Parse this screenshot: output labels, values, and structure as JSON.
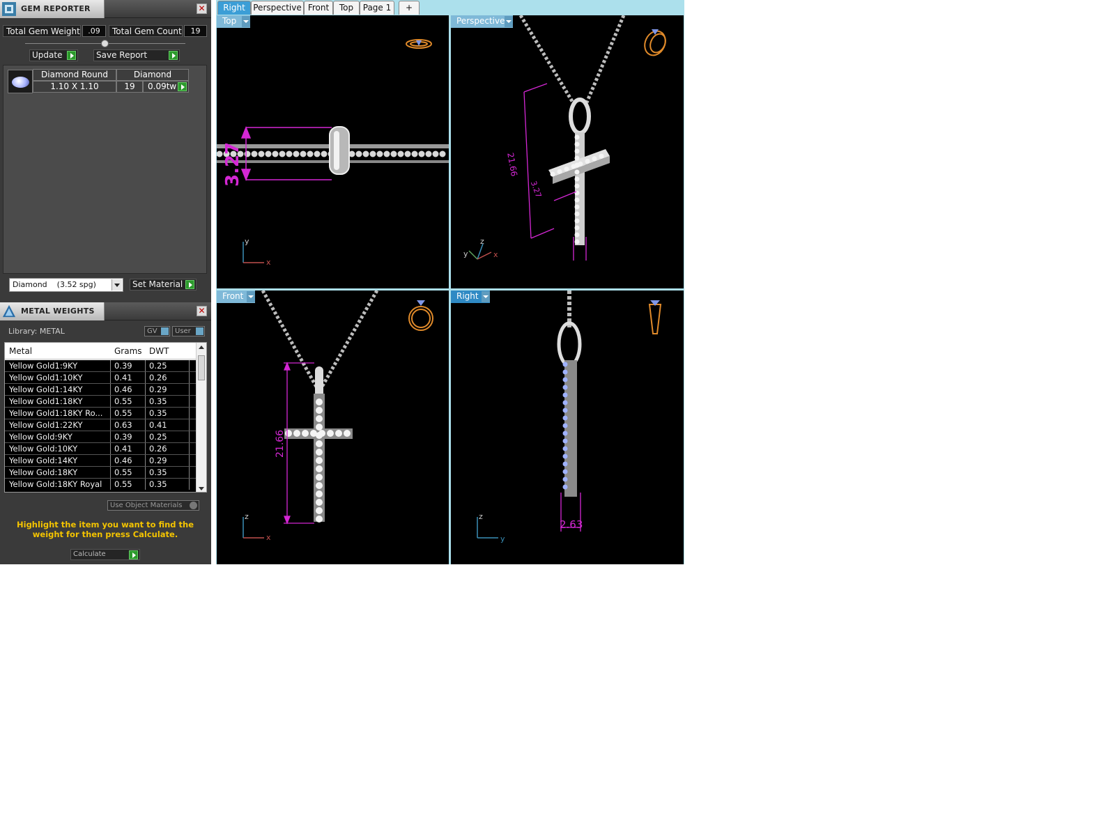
{
  "gem_reporter": {
    "title": "GEM REPORTER",
    "total_weight_label": "Total Gem Weight",
    "total_weight_value": ".09",
    "total_count_label": "Total Gem Count",
    "total_count_value": "19",
    "update_label": "Update",
    "save_label": "Save Report",
    "gem": {
      "shape": "Diamond Round",
      "material": "Diamond",
      "size": "1.10 X 1.10",
      "count": "19",
      "weight": "0.09tw"
    },
    "material_select": "Diamond    (3.52 spg)",
    "set_material_label": "Set Material"
  },
  "metal_weights": {
    "title": "METAL WEIGHTS",
    "library_label": "Library: METAL",
    "gv_label": "GV",
    "user_label": "User",
    "columns": [
      "Metal",
      "Grams",
      "DWT"
    ],
    "rows": [
      [
        "Yellow Gold1:9KY",
        "0.39",
        "0.25"
      ],
      [
        "Yellow Gold1:10KY",
        "0.41",
        "0.26"
      ],
      [
        "Yellow Gold1:14KY",
        "0.46",
        "0.29"
      ],
      [
        "Yellow Gold1:18KY",
        "0.55",
        "0.35"
      ],
      [
        "Yellow Gold1:18KY Ro...",
        "0.55",
        "0.35"
      ],
      [
        "Yellow Gold1:22KY",
        "0.63",
        "0.41"
      ],
      [
        "Yellow Gold:9KY",
        "0.39",
        "0.25"
      ],
      [
        "Yellow Gold:10KY",
        "0.41",
        "0.26"
      ],
      [
        "Yellow Gold:14KY",
        "0.46",
        "0.29"
      ],
      [
        "Yellow Gold:18KY",
        "0.55",
        "0.35"
      ],
      [
        "Yellow Gold:18KY Royal",
        "0.55",
        "0.35"
      ]
    ],
    "use_object_label": "Use Object Materials",
    "hint": "Highlight the item you want to find the weight for then press Calculate.",
    "calculate_label": "Calculate"
  },
  "viewport": {
    "tabs": [
      "Right",
      "Perspective",
      "Front",
      "Top",
      "Page 1",
      "+"
    ],
    "active_tab": "Right",
    "views": {
      "top": "Top",
      "perspective": "Perspective",
      "front": "Front",
      "right": "Right"
    },
    "dims": {
      "top": "3.27",
      "persp_a": "21.66",
      "persp_b": "3.27",
      "front": "21.66",
      "right": "2.63"
    },
    "axes": {
      "top": [
        "y",
        "x"
      ],
      "persp": [
        "z",
        "y",
        "x"
      ],
      "front": [
        "z",
        "x"
      ],
      "right": [
        "z",
        "y"
      ]
    }
  },
  "colors": {
    "accent": "#3c9ed6",
    "dimension": "#d427d4",
    "hint": "#f4c400",
    "go_button": "#2c9a2c"
  }
}
